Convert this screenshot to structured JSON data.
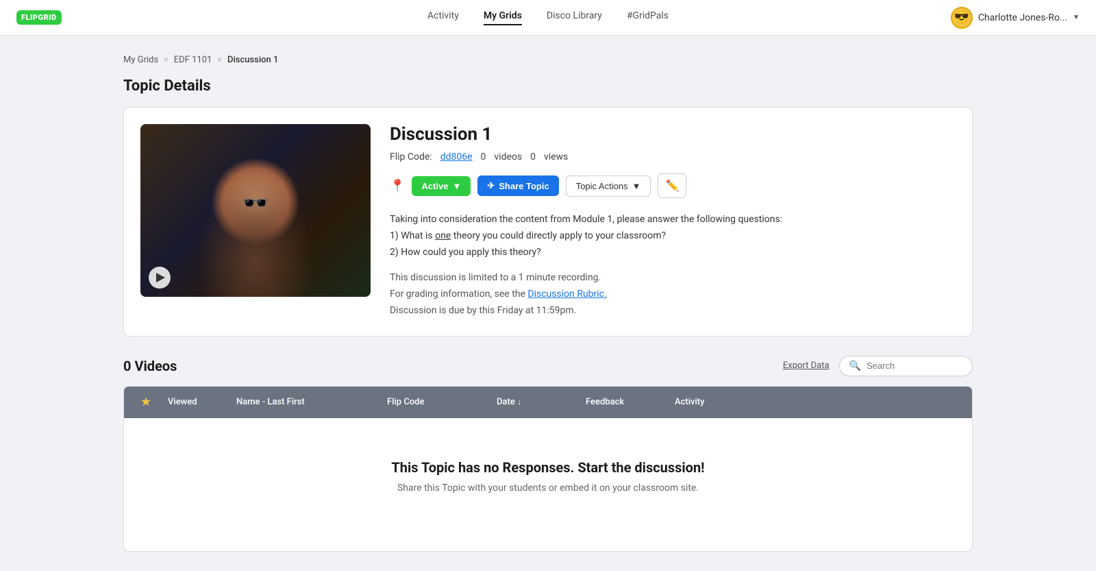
{
  "navbar": {
    "logo_text": "FLIPGRID",
    "links": [
      {
        "label": "Activity",
        "active": false
      },
      {
        "label": "My Grids",
        "active": true
      },
      {
        "label": "Disco Library",
        "active": false
      },
      {
        "label": "#GridPals",
        "active": false
      }
    ],
    "user": {
      "name": "Charlotte Jones-Ro...",
      "avatar_emoji": "😎"
    }
  },
  "breadcrumb": {
    "items": [
      "My Grids",
      "EDF 1101",
      "Discussion 1"
    ]
  },
  "page": {
    "title": "Topic Details"
  },
  "topic": {
    "title": "Discussion 1",
    "flip_code_label": "Flip Code:",
    "flip_code": "dd806e",
    "videos_count": "0",
    "videos_label": "videos",
    "views_count": "0",
    "views_label": "views",
    "btn_active": "Active",
    "btn_share": "Share Topic",
    "btn_topic_actions": "Topic Actions",
    "description_line1": "Taking into consideration the content from Module 1, please answer the following questions:",
    "description_line2": "1) What is one theory you could directly apply to your classroom?",
    "description_line3": "2) How could you apply this theory?",
    "note_line1": "This discussion is limited to a 1 minute recording.",
    "note_line2_prefix": "For grading information, see the ",
    "note_link": "Discussion Rubric.",
    "note_line3": "Discussion is due by this Friday at 11:59pm."
  },
  "videos_section": {
    "count_label": "0 Videos",
    "export_label": "Export Data",
    "search_placeholder": "Search",
    "table_headers": {
      "star": "★",
      "viewed": "Viewed",
      "name": "Name - Last First",
      "flip_code": "Flip Code",
      "date": "Date",
      "feedback": "Feedback",
      "activity": "Activity"
    },
    "empty_title": "This Topic has no Responses. Start the discussion!",
    "empty_sub": "Share this Topic with your students or embed it on your classroom site."
  }
}
